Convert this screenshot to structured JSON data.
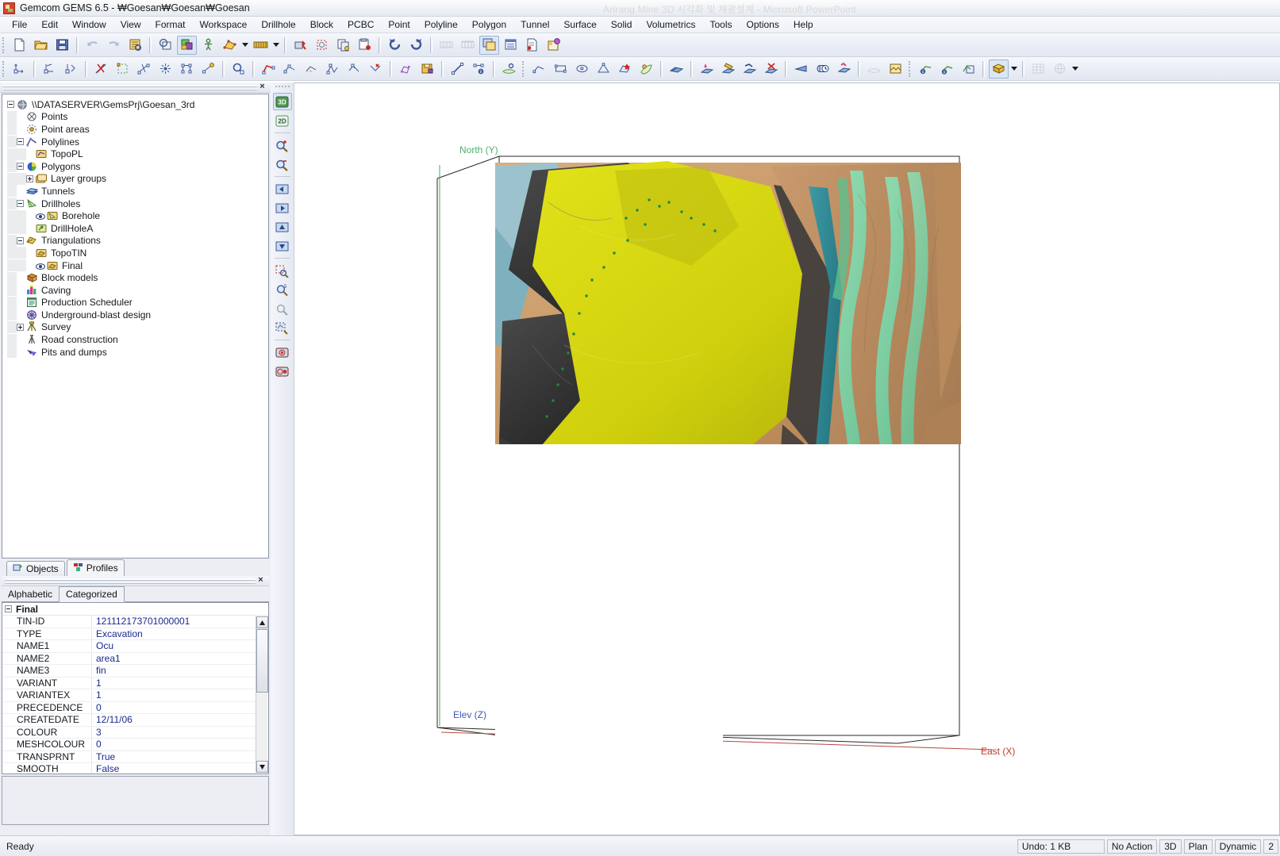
{
  "window": {
    "title": "Gemcom GEMS 6.5 - ₩Goesan₩Goesan₩Goesan",
    "background_window_title": "Arirang Mine 3D 시각화 및 채광설계 - Microsoft PowerPoint"
  },
  "menubar": {
    "items": [
      {
        "label": "File"
      },
      {
        "label": "Edit"
      },
      {
        "label": "Window"
      },
      {
        "label": "View"
      },
      {
        "label": "Format"
      },
      {
        "label": "Workspace"
      },
      {
        "label": "Drillhole"
      },
      {
        "label": "Block"
      },
      {
        "label": "PCBC"
      },
      {
        "label": "Point"
      },
      {
        "label": "Polyline"
      },
      {
        "label": "Polygon"
      },
      {
        "label": "Tunnel"
      },
      {
        "label": "Surface"
      },
      {
        "label": "Solid"
      },
      {
        "label": "Volumetrics"
      },
      {
        "label": "Tools"
      },
      {
        "label": "Options"
      },
      {
        "label": "Help"
      }
    ]
  },
  "toolbar_row1": {
    "icons": [
      "new-document-icon",
      "open-folder-icon",
      "save-disk-icon",
      "undo-arrow-icon",
      "redo-arrow-icon",
      "print-preview-icon",
      "workspace-icon",
      "layers-colour-icon",
      "figure-icon",
      "triangulation-yellow-icon",
      "legend-bar-icon",
      "point-marker-red-icon",
      "selection-dashed-icon",
      "copy-page-icon",
      "paste-page-icon",
      "rotate-left-icon",
      "rotate-right-icon",
      "section-left-icon",
      "section-right-icon",
      "window-cascade-icon",
      "report-table-icon",
      "document-check-icon",
      "help-balloon-icon"
    ]
  },
  "toolbar_row2": {
    "icons": [
      "move-point-icon",
      "copy-point-icon",
      "translate-point-icon",
      "delete-line-icon",
      "select-region-icon",
      "node-edit-icon",
      "radial-node-icon",
      "segment-nodes-icon",
      "link-node-icon",
      "inspect-magnifier-icon",
      "polyline-red-icon",
      "polyline-node-icon",
      "polyline-star-icon",
      "triangle-node-icon",
      "polyline-blue-icon",
      "polyline-chain-icon",
      "polyline-cross-icon",
      "polyline-bend-icon",
      "polyline-arrow-icon",
      "polyline-explode-icon",
      "polygon-nodes-icon",
      "polygon-save-icon",
      "line-measure-icon",
      "node-info-icon",
      "surface-drape-icon",
      "polyline-plain-icon",
      "rectangle-icon",
      "ellipse-icon",
      "triangle-icon",
      "surface-star-icon",
      "surface-leaf-icon",
      "tunnel-blue-icon",
      "tunnel-design-icon",
      "tunnel-edit-icon",
      "tunnel-join-icon",
      "tunnel-delete-icon",
      "wedge-icon",
      "cylinder-clock-icon",
      "tunnel-pink-icon",
      "surface-flat-icon",
      "image-drape-icon",
      "solid-info-icon",
      "solid-info2-icon",
      "solid-frame-icon",
      "block-model-icon",
      "grid-table-icon",
      "grid-globe-icon"
    ]
  },
  "sidebar_viewtools": {
    "items": [
      {
        "name": "view-3d-button",
        "label": "3D",
        "active": true
      },
      {
        "name": "view-2d-button",
        "label": "2D",
        "active": false
      },
      {
        "name": "zoom-in-button",
        "label": "",
        "active": false
      },
      {
        "name": "zoom-out-button",
        "label": "",
        "active": false
      },
      {
        "name": "pan-left-button",
        "label": "",
        "active": false
      },
      {
        "name": "pan-right-button",
        "label": "",
        "active": false
      },
      {
        "name": "pan-up-button",
        "label": "",
        "active": false
      },
      {
        "name": "pan-down-button",
        "label": "",
        "active": false
      },
      {
        "name": "zoom-window-button",
        "label": "",
        "active": false
      },
      {
        "name": "zoom-previous-button",
        "label": "",
        "active": false
      },
      {
        "name": "zoom-all-button",
        "label": "",
        "active": false
      },
      {
        "name": "zoom-extents-button",
        "label": "",
        "active": false
      },
      {
        "name": "snapshot-button",
        "label": "",
        "active": false
      },
      {
        "name": "record-button",
        "label": "",
        "active": false
      }
    ]
  },
  "tree": {
    "root_label": "\\\\DATASERVER\\GemsPrj\\Goesan_3rd",
    "items": [
      {
        "label": "\\\\DATASERVER\\GemsPrj\\Goesan_3rd",
        "depth": 0,
        "expander": "minus",
        "icon": "globe-icon",
        "eye": false
      },
      {
        "label": "Points",
        "depth": 1,
        "expander": "none",
        "icon": "points-icon",
        "eye": false
      },
      {
        "label": "Point areas",
        "depth": 1,
        "expander": "none",
        "icon": "point-areas-icon",
        "eye": false
      },
      {
        "label": "Polylines",
        "depth": 1,
        "expander": "minus",
        "icon": "polylines-icon",
        "eye": false
      },
      {
        "label": "TopoPL",
        "depth": 2,
        "expander": "none",
        "icon": "folder-polyline-icon",
        "eye": false
      },
      {
        "label": "Polygons",
        "depth": 1,
        "expander": "minus",
        "icon": "polygons-icon",
        "eye": false
      },
      {
        "label": "Layer groups",
        "depth": 2,
        "expander": "plus",
        "icon": "folder-stack-icon",
        "eye": false
      },
      {
        "label": "Tunnels",
        "depth": 1,
        "expander": "none",
        "icon": "tunnels-icon",
        "eye": false
      },
      {
        "label": "Drillholes",
        "depth": 1,
        "expander": "minus",
        "icon": "drillholes-icon",
        "eye": false
      },
      {
        "label": "Borehole",
        "depth": 2,
        "expander": "none",
        "icon": "folder-drill-icon",
        "eye": true
      },
      {
        "label": "DrillHoleA",
        "depth": 2,
        "expander": "none",
        "icon": "folder-green-icon",
        "eye": false
      },
      {
        "label": "Triangulations",
        "depth": 1,
        "expander": "minus",
        "icon": "triangulations-icon",
        "eye": false
      },
      {
        "label": "TopoTIN",
        "depth": 2,
        "expander": "none",
        "icon": "folder-tin-icon",
        "eye": false
      },
      {
        "label": "Final",
        "depth": 2,
        "expander": "none",
        "icon": "folder-tin-icon",
        "eye": true
      },
      {
        "label": "Block models",
        "depth": 1,
        "expander": "none",
        "icon": "block-models-icon",
        "eye": false
      },
      {
        "label": "Caving",
        "depth": 1,
        "expander": "none",
        "icon": "caving-icon",
        "eye": false
      },
      {
        "label": "Production Scheduler",
        "depth": 1,
        "expander": "none",
        "icon": "scheduler-icon",
        "eye": false
      },
      {
        "label": "Underground-blast design",
        "depth": 1,
        "expander": "none",
        "icon": "blast-design-icon",
        "eye": false
      },
      {
        "label": "Survey",
        "depth": 1,
        "expander": "plus",
        "icon": "survey-icon",
        "eye": false
      },
      {
        "label": "Road construction",
        "depth": 1,
        "expander": "none",
        "icon": "road-icon",
        "eye": false
      },
      {
        "label": "Pits and dumps",
        "depth": 1,
        "expander": "none",
        "icon": "pits-dumps-icon",
        "eye": false
      }
    ]
  },
  "object_tabs": [
    {
      "label": "Objects",
      "icon": "objects-icon",
      "active": false
    },
    {
      "label": "Profiles",
      "icon": "profiles-icon",
      "active": true
    }
  ],
  "properties": {
    "tabs": [
      {
        "label": "Alphabetic",
        "active": false
      },
      {
        "label": "Categorized",
        "active": true
      }
    ],
    "category": "Final",
    "rows": [
      {
        "name": "TIN-ID",
        "value": "121112173701000001"
      },
      {
        "name": "TYPE",
        "value": "Excavation"
      },
      {
        "name": "NAME1",
        "value": "Ocu"
      },
      {
        "name": "NAME2",
        "value": "area1"
      },
      {
        "name": "NAME3",
        "value": "fin"
      },
      {
        "name": "VARIANT",
        "value": "1"
      },
      {
        "name": "VARIANTEX",
        "value": "1"
      },
      {
        "name": "PRECEDENCE",
        "value": "0"
      },
      {
        "name": "CREATEDATE",
        "value": "12/11/06"
      },
      {
        "name": "COLOUR",
        "value": "3"
      },
      {
        "name": "MESHCOLOUR",
        "value": "0"
      },
      {
        "name": "TRANSPRNT",
        "value": "True"
      },
      {
        "name": "SMOOTH",
        "value": "False"
      }
    ]
  },
  "viewport": {
    "axis_labels": {
      "north": "North (Y)",
      "east": "East (X)",
      "elev": "Elev (Z)"
    },
    "axis_colors": {
      "north": "#4caf6e",
      "east": "#c0392b",
      "elev": "#4257b2"
    },
    "surface_colors": {
      "ore_yellow": "#d4d40e",
      "terrain_tan": "#c89a6a",
      "dark_shale": "#3c3c3c",
      "green_vein": "#7fd0a4",
      "teal_band": "#2f8a96",
      "pale_blue": "#9fc5cf"
    }
  },
  "statusbar": {
    "ready": "Ready",
    "panes": [
      {
        "name": "undo-pane",
        "label": "Undo: 1 KB"
      },
      {
        "name": "action-pane",
        "label": "No Action"
      },
      {
        "name": "mode-pane",
        "label": "3D"
      },
      {
        "name": "view-pane",
        "label": "Plan"
      },
      {
        "name": "dynamic-pane",
        "label": "Dynamic"
      },
      {
        "name": "count-pane",
        "label": "2"
      }
    ]
  }
}
